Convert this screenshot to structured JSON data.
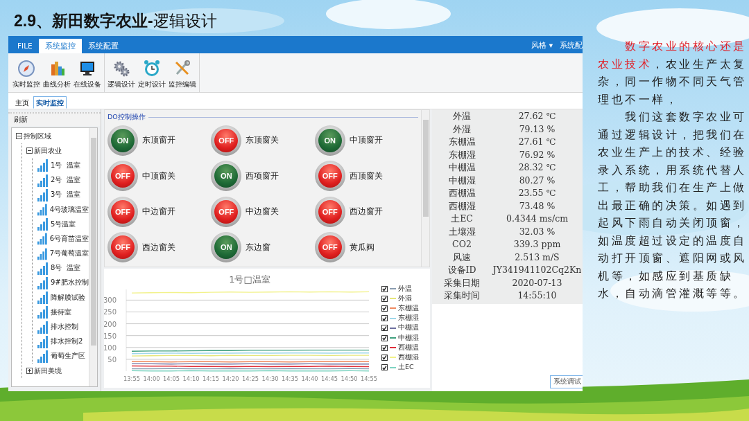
{
  "slide_title": "**2.9、新田数字农业-**逻辑设计",
  "window": {
    "ribbon_tabs": [
      {
        "label": "FILE",
        "selected": false
      },
      {
        "label": "系统监控",
        "selected": true
      },
      {
        "label": "系统配置",
        "selected": false
      }
    ],
    "ribbon_right": [
      "风格 ▾",
      "系统配"
    ],
    "toolbar": [
      {
        "label": "实时监控",
        "kind": "compass"
      },
      {
        "label": "曲线分析",
        "kind": "bars"
      },
      {
        "label": "在线设备",
        "kind": "monitor"
      },
      {
        "label": "逻辑设计",
        "kind": "gears"
      },
      {
        "label": "定时设计",
        "kind": "clock"
      },
      {
        "label": "监控编辑",
        "kind": "tools"
      }
    ],
    "doc_tabs": [
      {
        "label": "主页",
        "selected": false
      },
      {
        "label": "实时监控",
        "selected": true
      }
    ],
    "left_panel": {
      "header": "刷新",
      "tree": [
        {
          "label": "控制区域",
          "expanded": true,
          "children": [
            {
              "label": "新田农业",
              "expanded": true,
              "children": [
                {
                  "label": "1号  温室"
                },
                {
                  "label": "2号  温室"
                },
                {
                  "label": "3号  温室"
                },
                {
                  "label": "4号玻璃温室"
                },
                {
                  "label": "5号温室"
                },
                {
                  "label": "6号育苗温室"
                },
                {
                  "label": "7号葡萄温室"
                },
                {
                  "label": "8号  温室"
                },
                {
                  "label": "9#肥水控制"
                },
                {
                  "label": "降解膜试验"
                },
                {
                  "label": "接待室"
                },
                {
                  "label": "排水控制"
                },
                {
                  "label": "排水控制2"
                },
                {
                  "label": "葡萄生产区"
                }
              ]
            },
            {
              "label": "新田美境",
              "expanded": false
            }
          ]
        }
      ]
    },
    "do_group": {
      "title": "DO控制操作",
      "switches": [
        {
          "caption": "ON",
          "on": true,
          "label": "东顶窗开"
        },
        {
          "caption": "OFF",
          "on": false,
          "label": "东顶窗关"
        },
        {
          "caption": "ON",
          "on": true,
          "label": "中顶窗开"
        },
        {
          "caption": "OFF",
          "on": false,
          "label": "中顶窗关"
        },
        {
          "caption": "ON",
          "on": true,
          "label": "西项窗开"
        },
        {
          "caption": "OFF",
          "on": false,
          "label": "西顶窗关"
        },
        {
          "caption": "OFF",
          "on": false,
          "label": "中边窗开"
        },
        {
          "caption": "OFF",
          "on": false,
          "label": "中边窗关"
        },
        {
          "caption": "OFF",
          "on": false,
          "label": "西边窗开"
        },
        {
          "caption": "OFF",
          "on": false,
          "label": "西边窗关"
        },
        {
          "caption": "ON",
          "on": true,
          "label": "东边窗"
        },
        {
          "caption": "OFF",
          "on": false,
          "label": "黄瓜阀"
        }
      ]
    },
    "chart": {
      "legend_items": [
        {
          "checked": true
        },
        {
          "checked": true
        },
        {
          "checked": true
        },
        {
          "checked": true
        },
        {
          "checked": true
        },
        {
          "checked": true
        },
        {
          "checked": true
        },
        {
          "checked": true
        },
        {
          "checked": true
        }
      ],
      "chart_data": {
        "type": "line",
        "title": "1号□温室",
        "grid": true,
        "legend": "right",
        "categories": [
          "13:55",
          "14:00",
          "14:05",
          "14:10",
          "14:15",
          "14:20",
          "14:25",
          "14:30",
          "14:35",
          "14:40",
          "14:45",
          "14:50",
          "14:55"
        ],
        "ylim": [
          0,
          345
        ],
        "yticks": [
          50,
          100,
          150,
          200,
          250,
          300
        ],
        "series": [
          {
            "name": "外温",
            "color": "#8a9cb0",
            "values": [
              10,
              10,
              11,
              10,
              10,
              11,
              10,
              10,
              11,
              10,
              10,
              11,
              10
            ]
          },
          {
            "name": "外湿",
            "color": "#e6e67a",
            "values": [
              64,
              65,
              66,
              66,
              65,
              67,
              66,
              66,
              67,
              67,
              66,
              67,
              67
            ]
          },
          {
            "name": "东棚温",
            "color": "#f08a60",
            "values": [
              40,
              40,
              39,
              40,
              40,
              39,
              40,
              40,
              39,
              40,
              40,
              40,
              40
            ]
          },
          {
            "name": "东棚湿",
            "color": "#9fd8ea",
            "values": [
              74,
              75,
              76,
              75,
              76,
              76,
              77,
              76,
              77,
              77,
              76,
              77,
              77
            ]
          },
          {
            "name": "中棚温",
            "color": "#6e70a0",
            "values": [
              31,
              31,
              30,
              31,
              30,
              30,
              31,
              30,
              30,
              31,
              30,
              30,
              30
            ]
          },
          {
            "name": "中棚湿",
            "color": "#3fa07e",
            "values": [
              84,
              85,
              85,
              86,
              87,
              87,
              88,
              88,
              88,
              89,
              89,
              89,
              89
            ]
          },
          {
            "name": "西棚温",
            "color": "#e0303c",
            "values": [
              22,
              21,
              21,
              20,
              20,
              19,
              20,
              19,
              20,
              20,
              21,
              20,
              19
            ]
          },
          {
            "name": "西棚湿",
            "color": "#f2f28a",
            "values": [
              330,
              331,
              332,
              331,
              333,
              334,
              333,
              334,
              335,
              334,
              335,
              334,
              335
            ]
          },
          {
            "name": "土EC",
            "color": "#7fd4c2",
            "values": [
              2,
              1,
              1,
              2,
              1,
              1,
              1,
              2,
              1,
              1,
              1,
              2,
              1
            ]
          }
        ]
      }
    },
    "readings": [
      {
        "label": "外温",
        "value": "27.62 ℃"
      },
      {
        "label": "外湿",
        "value": "79.13 %"
      },
      {
        "label": "东棚温",
        "value": "27.61 ℃"
      },
      {
        "label": "东棚湿",
        "value": "76.92 %"
      },
      {
        "label": "中棚温",
        "value": "28.32 ℃"
      },
      {
        "label": "中棚湿",
        "value": "80.27 %"
      },
      {
        "label": "西棚温",
        "value": "23.55 ℃"
      },
      {
        "label": "西棚湿",
        "value": "73.48 %"
      },
      {
        "label": "土EC",
        "value": "0.4344 ms/cm"
      },
      {
        "label": "土壤湿",
        "value": "32.03 %"
      },
      {
        "label": "CO2",
        "value": "339.3 ppm"
      },
      {
        "label": "风速",
        "value": "2.513 m/S"
      },
      {
        "label": "设备ID",
        "value": "JY341941102Cq2Kn"
      },
      {
        "label": "采集日期",
        "value": "2020-07-13"
      },
      {
        "label": "采集时间",
        "value": "14:55:10"
      }
    ],
    "bottom_tab": "系统调试"
  },
  "notes": [
    {
      "highlight": "数字农业的核心还是农业技术",
      "text": "，农业生产太复杂，同一作物不同天气管理也不一样，"
    },
    {
      "text": "我们这套数字农业可通过逻辑设计，把我们在农业生产上的技术、经验录入系统，用系统代替人工，帮助我们在生产上做出最正确的决策。如遇到起风下雨自动关闭顶窗，如温度超过设定的温度自动打开顶窗、遮阳网或风机等，如感应到基质缺水，自动滴管灌溉等等。"
    }
  ]
}
